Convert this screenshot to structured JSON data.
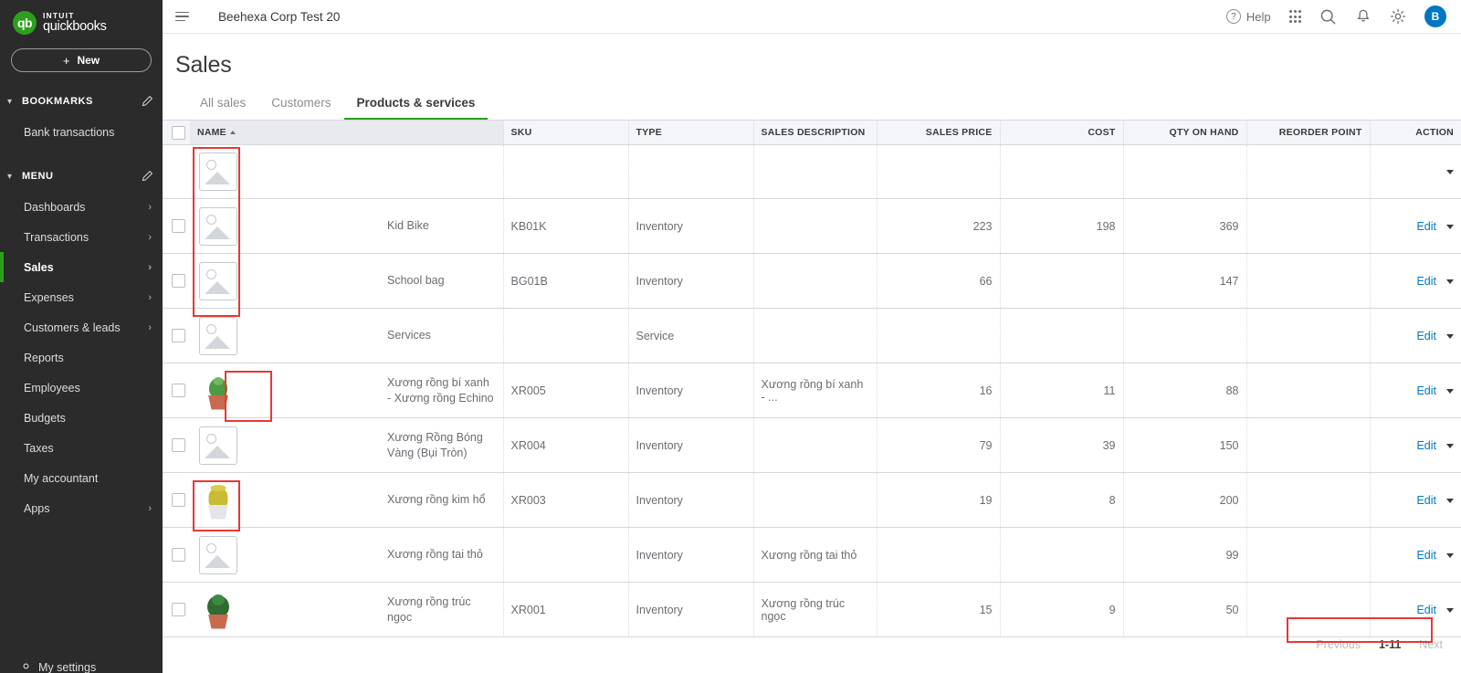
{
  "sidebar": {
    "brand": {
      "intuit": "INTUIT",
      "product": "quickbooks",
      "logo_mark": "qb"
    },
    "new_button": {
      "label": "New",
      "plus": "+"
    },
    "bookmarks": {
      "title": "BOOKMARKS",
      "edit_icon": "pencil-icon",
      "items": [
        {
          "label": "Bank transactions"
        }
      ]
    },
    "menu": {
      "title": "MENU",
      "edit_icon": "pencil-icon",
      "items": [
        {
          "label": "Dashboards",
          "has_arrow": true,
          "active": false
        },
        {
          "label": "Transactions",
          "has_arrow": true,
          "active": false
        },
        {
          "label": "Sales",
          "has_arrow": true,
          "active": true
        },
        {
          "label": "Expenses",
          "has_arrow": true,
          "active": false
        },
        {
          "label": "Customers & leads",
          "has_arrow": true,
          "active": false
        },
        {
          "label": "Reports",
          "has_arrow": false,
          "active": false
        },
        {
          "label": "Employees",
          "has_arrow": false,
          "active": false
        },
        {
          "label": "Budgets",
          "has_arrow": false,
          "active": false
        },
        {
          "label": "Taxes",
          "has_arrow": false,
          "active": false
        },
        {
          "label": "My accountant",
          "has_arrow": false,
          "active": false
        },
        {
          "label": "Apps",
          "has_arrow": true,
          "active": false
        }
      ]
    },
    "bottom_partial": {
      "label": "My settings"
    }
  },
  "topbar": {
    "menu_toggle_icon": "hamburger-collapse-icon",
    "company_name": "Beehexa Corp Test 20",
    "help_label": "Help",
    "help_icon": "question-circle-icon",
    "grid_icon": "apps-grid-icon",
    "search_icon": "search-icon",
    "notifications_icon": "bell-icon",
    "settings_icon": "gear-icon",
    "avatar_initial": "B",
    "avatar_color": "#0077c5"
  },
  "page": {
    "title": "Sales",
    "tabs": [
      {
        "label": "All sales",
        "active": false
      },
      {
        "label": "Customers",
        "active": false
      },
      {
        "label": "Products & services",
        "active": true
      }
    ]
  },
  "table": {
    "select_all_checkbox": "select-all",
    "columns": [
      {
        "key": "name",
        "label": "NAME",
        "align": "left",
        "sorted": true,
        "sort_dir": "asc"
      },
      {
        "key": "sku",
        "label": "SKU",
        "align": "left"
      },
      {
        "key": "type",
        "label": "TYPE",
        "align": "left"
      },
      {
        "key": "sales_description",
        "label": "SALES DESCRIPTION",
        "align": "left"
      },
      {
        "key": "sales_price",
        "label": "SALES PRICE",
        "align": "right"
      },
      {
        "key": "cost",
        "label": "COST",
        "align": "right"
      },
      {
        "key": "qty_on_hand",
        "label": "QTY ON HAND",
        "align": "right"
      },
      {
        "key": "reorder_point",
        "label": "REORDER POINT",
        "align": "right"
      },
      {
        "key": "action",
        "label": "ACTION",
        "align": "right"
      }
    ],
    "action_label": "Edit",
    "rows": [
      {
        "partial": true,
        "thumb": "placeholder",
        "highlight": false,
        "name": "",
        "sku": "",
        "type": "",
        "sales_description": "",
        "sales_price": "",
        "cost": "",
        "qty_on_hand": "",
        "reorder_point": ""
      },
      {
        "thumb": "placeholder",
        "highlight": true,
        "name": "Kid Bike",
        "sku": "KB01K",
        "type": "Inventory",
        "sales_description": "",
        "sales_price": "223",
        "cost": "198",
        "qty_on_hand": "369",
        "reorder_point": ""
      },
      {
        "thumb": "placeholder",
        "highlight": true,
        "name": "School bag",
        "sku": "BG01B",
        "type": "Inventory",
        "sales_description": "",
        "sales_price": "66",
        "cost": "",
        "qty_on_hand": "147",
        "reorder_point": ""
      },
      {
        "thumb": "placeholder",
        "highlight": true,
        "name": "Services",
        "sku": "",
        "type": "Service",
        "sales_description": "",
        "sales_price": "",
        "cost": "",
        "qty_on_hand": "",
        "reorder_point": ""
      },
      {
        "thumb": "cactus-echino",
        "highlight": false,
        "name": "Xương rồng bí xanh - Xương rồng Echino",
        "sku": "XR005",
        "type": "Inventory",
        "sales_description": "Xương rồng bí xanh - ...",
        "sales_price": "16",
        "cost": "11",
        "qty_on_hand": "88",
        "reorder_point": ""
      },
      {
        "thumb": "placeholder",
        "highlight": true,
        "name": "Xương Rồng Bóng Vàng (Bụi Tròn)",
        "sku": "XR004",
        "type": "Inventory",
        "sales_description": "",
        "sales_price": "79",
        "cost": "39",
        "qty_on_hand": "150",
        "reorder_point": ""
      },
      {
        "thumb": "cactus-golden",
        "highlight": false,
        "name": "Xương rồng kim hổ",
        "sku": "XR003",
        "type": "Inventory",
        "sales_description": "",
        "sales_price": "19",
        "cost": "8",
        "qty_on_hand": "200",
        "reorder_point": ""
      },
      {
        "thumb": "placeholder",
        "highlight": true,
        "name": "Xương rồng tai thỏ",
        "sku": "",
        "type": "Inventory",
        "sales_description": "Xương rồng tai thỏ",
        "sales_price": "",
        "cost": "",
        "qty_on_hand": "99",
        "reorder_point": ""
      },
      {
        "thumb": "cactus-green",
        "highlight": false,
        "name": "Xương rồng trúc ngọc",
        "sku": "XR001",
        "type": "Inventory",
        "sales_description": "Xương rồng trúc ngọc",
        "sales_price": "15",
        "cost": "9",
        "qty_on_hand": "50",
        "reorder_point": ""
      }
    ]
  },
  "pagination": {
    "previous_label": "Previous",
    "range_label": "1-11",
    "next_label": "Next",
    "highlighted": true
  },
  "colors": {
    "brand_green": "#2ca01c",
    "link_blue": "#0077c5",
    "sidebar_bg": "#2b2b2b",
    "annotation_red": "#e53935",
    "header_bg": "#f4f5f8"
  }
}
